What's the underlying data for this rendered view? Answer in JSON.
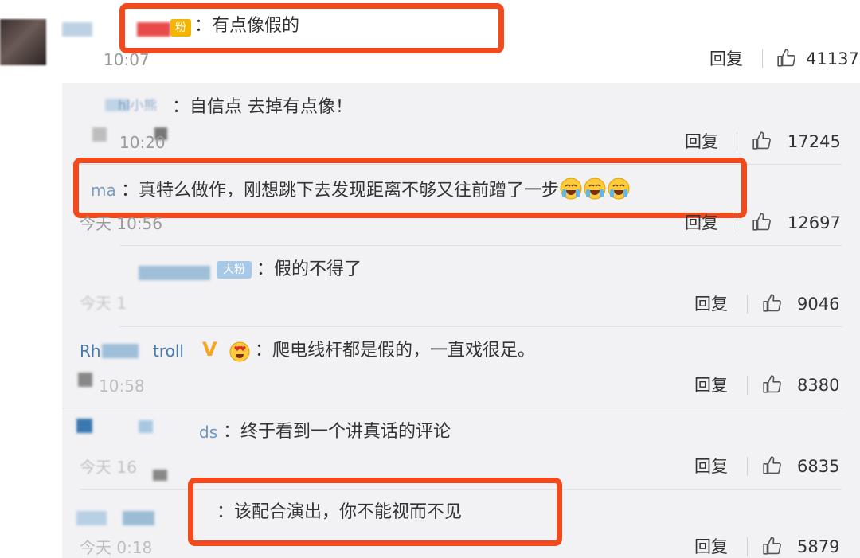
{
  "actions": {
    "reply": "回复"
  },
  "colors": {
    "highlight": "#f24a1c",
    "panel": "#f2f2f5",
    "verified": "#f5a623"
  },
  "icons": {
    "like": "thumbs-up-icon",
    "emoji": "crying-laughing-emoji-icon"
  },
  "top_comment": {
    "name_fragment": "",
    "badge": "粉",
    "text": "：有点像假的",
    "time": "10:07",
    "likes": "41137"
  },
  "replies": [
    {
      "name_fragment": "hl小熊",
      "text": "：自信点 去掉有点像！",
      "time": "10:20",
      "likes": "17245"
    },
    {
      "name_fragment": "ma",
      "text": "：真特么做作，刚想跳下去发现距离不够又往前蹭了一步",
      "time": "今天 10:56",
      "likes": "12697"
    },
    {
      "name_fragment": "",
      "badge": "大粉",
      "text": "：假的不得了",
      "time": "今天 1",
      "likes": "9046"
    },
    {
      "name_fragment": "Rh",
      "name_fragment_2": "troll",
      "verified": "V",
      "text": "：爬电线杆都是假的，一直戏很足。",
      "time": "10:58",
      "likes": "8380"
    },
    {
      "name_fragment": "ds",
      "text": "：终于看到一个讲真话的评论",
      "time": "今天 16",
      "likes": "6835"
    },
    {
      "name_fragment": "",
      "text": "：该配合演出，你不能视而不见",
      "time": "今天 0:18",
      "likes": "5879"
    }
  ]
}
